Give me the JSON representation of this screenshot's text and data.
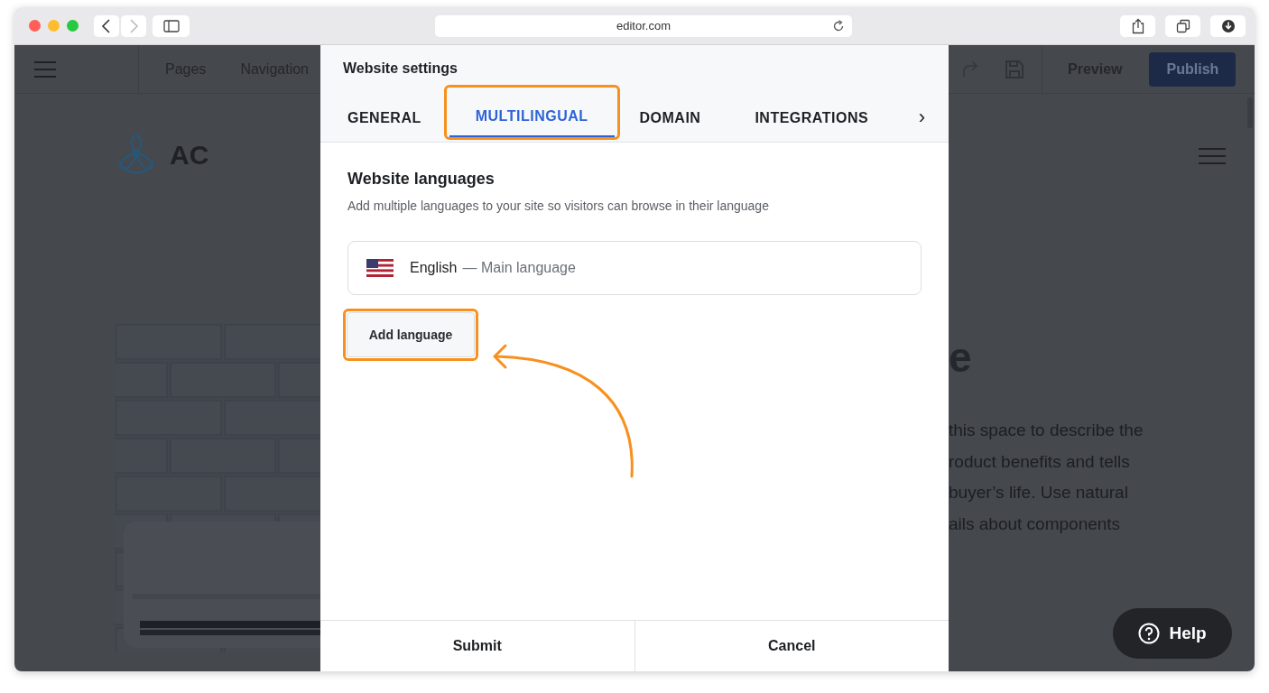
{
  "browser": {
    "url": "editor.com"
  },
  "editor_toolbar": {
    "menu_items": [
      {
        "label": "Pages"
      },
      {
        "label": "Navigation"
      }
    ],
    "preview": "Preview",
    "publish": "Publish"
  },
  "site_preview": {
    "logo_text": "AC",
    "heading_fragment": "e",
    "paragraph_fragments": [
      "this space to describe the",
      "roduct benefits and tells",
      "buyer’s life. Use natural",
      "ails about components"
    ],
    "help": "Help"
  },
  "dialog": {
    "title": "Website settings",
    "tabs": [
      {
        "label": "GENERAL",
        "selected": false,
        "highlighted": false
      },
      {
        "label": "MULTILINGUAL",
        "selected": true,
        "highlighted": true
      },
      {
        "label": "DOMAIN",
        "selected": false,
        "highlighted": false
      },
      {
        "label": "INTEGRATIONS",
        "selected": false,
        "highlighted": false
      }
    ],
    "more_tabs": "›",
    "section_title": "Website languages",
    "section_description": "Add multiple languages to your site so visitors can browse in their language",
    "languages": [
      {
        "name": "English",
        "role": "— Main language"
      }
    ],
    "add_button": {
      "label": "Add language",
      "highlighted": true
    },
    "footer_buttons": [
      "Submit",
      "Cancel"
    ]
  }
}
